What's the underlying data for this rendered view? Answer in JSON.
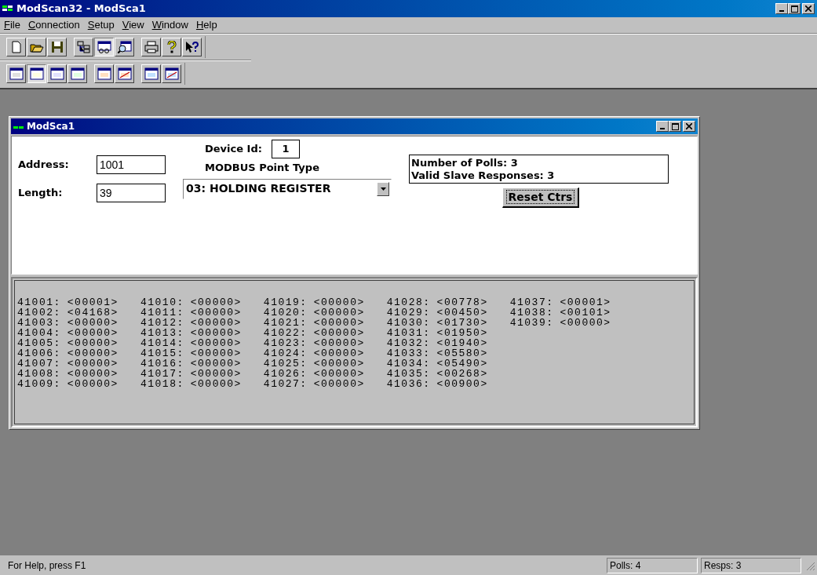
{
  "window": {
    "title": "ModScan32 - ModSca1"
  },
  "menu": [
    {
      "mnemonic": "F",
      "rest": "ile"
    },
    {
      "mnemonic": "C",
      "rest": "onnection"
    },
    {
      "mnemonic": "S",
      "rest": "etup"
    },
    {
      "mnemonic": "V",
      "rest": "iew"
    },
    {
      "mnemonic": "W",
      "rest": "indow"
    },
    {
      "mnemonic": "H",
      "rest": "elp"
    }
  ],
  "toolbars": [
    [
      {
        "kind": "new",
        "selected": false
      },
      {
        "kind": "open",
        "selected": false
      },
      {
        "kind": "save",
        "selected": false
      },
      {
        "kind": "sep"
      },
      {
        "kind": "tree",
        "selected": false
      },
      {
        "kind": "display",
        "selected": true
      },
      {
        "kind": "inspect",
        "selected": false
      },
      {
        "kind": "sep"
      },
      {
        "kind": "print",
        "selected": false
      },
      {
        "kind": "help",
        "selected": false
      },
      {
        "kind": "context-help",
        "selected": false
      }
    ],
    [
      {
        "kind": "fmt-bin",
        "selected": false
      },
      {
        "kind": "fmt-dec",
        "selected": true
      },
      {
        "kind": "fmt-int",
        "selected": false
      },
      {
        "kind": "fmt-hex",
        "selected": false
      },
      {
        "kind": "sep"
      },
      {
        "kind": "fmt-float",
        "selected": false
      },
      {
        "kind": "fmt-float-swap",
        "selected": false
      },
      {
        "kind": "sep"
      },
      {
        "kind": "fmt-double",
        "selected": false
      },
      {
        "kind": "fmt-double-swap",
        "selected": false
      }
    ]
  ],
  "child_window": {
    "title": "ModSca1",
    "address": {
      "label": "Address:",
      "value": "1001"
    },
    "length": {
      "label": "Length:",
      "value": "39"
    },
    "device_id": {
      "label": "Device Id:",
      "value": "1"
    },
    "point_type": {
      "label": "MODBUS Point Type",
      "value": "03: HOLDING REGISTER"
    },
    "counters": [
      "Number of Polls: 3",
      "Valid Slave Responses: 3"
    ],
    "reset_button": "Reset Ctrs",
    "registers": [
      {
        "address": "41001:",
        "value": "<00001>"
      },
      {
        "address": "41002:",
        "value": "<04168>"
      },
      {
        "address": "41003:",
        "value": "<00000>"
      },
      {
        "address": "41004:",
        "value": "<00000>"
      },
      {
        "address": "41005:",
        "value": "<00000>"
      },
      {
        "address": "41006:",
        "value": "<00000>"
      },
      {
        "address": "41007:",
        "value": "<00000>"
      },
      {
        "address": "41008:",
        "value": "<00000>"
      },
      {
        "address": "41009:",
        "value": "<00000>"
      },
      {
        "address": "41010:",
        "value": "<00000>"
      },
      {
        "address": "41011:",
        "value": "<00000>"
      },
      {
        "address": "41012:",
        "value": "<00000>"
      },
      {
        "address": "41013:",
        "value": "<00000>"
      },
      {
        "address": "41014:",
        "value": "<00000>"
      },
      {
        "address": "41015:",
        "value": "<00000>"
      },
      {
        "address": "41016:",
        "value": "<00000>"
      },
      {
        "address": "41017:",
        "value": "<00000>"
      },
      {
        "address": "41018:",
        "value": "<00000>"
      },
      {
        "address": "41019:",
        "value": "<00000>"
      },
      {
        "address": "41020:",
        "value": "<00000>"
      },
      {
        "address": "41021:",
        "value": "<00000>"
      },
      {
        "address": "41022:",
        "value": "<00000>"
      },
      {
        "address": "41023:",
        "value": "<00000>"
      },
      {
        "address": "41024:",
        "value": "<00000>"
      },
      {
        "address": "41025:",
        "value": "<00000>"
      },
      {
        "address": "41026:",
        "value": "<00000>"
      },
      {
        "address": "41027:",
        "value": "<00000>"
      },
      {
        "address": "41028:",
        "value": "<00778>"
      },
      {
        "address": "41029:",
        "value": "<00450>"
      },
      {
        "address": "41030:",
        "value": "<01730>"
      },
      {
        "address": "41031:",
        "value": "<01950>"
      },
      {
        "address": "41032:",
        "value": "<01940>"
      },
      {
        "address": "41033:",
        "value": "<05580>"
      },
      {
        "address": "41034:",
        "value": "<05490>"
      },
      {
        "address": "41035:",
        "value": "<00268>"
      },
      {
        "address": "41036:",
        "value": "<00900>"
      },
      {
        "address": "41037:",
        "value": "<00001>"
      },
      {
        "address": "41038:",
        "value": "<00101>"
      },
      {
        "address": "41039:",
        "value": "<00000>"
      }
    ]
  },
  "status_bar": {
    "help": "For Help, press F1",
    "polls": "Polls: 4",
    "resps": "Resps: 3"
  }
}
